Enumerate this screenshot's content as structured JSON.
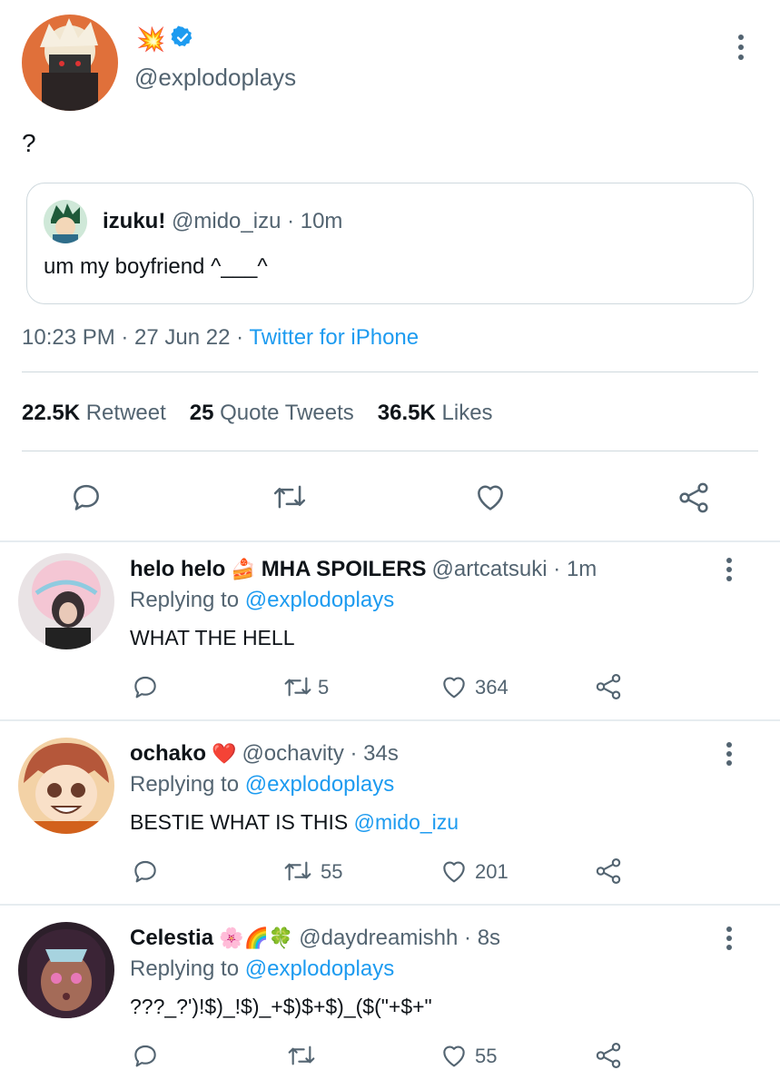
{
  "main_tweet": {
    "emoji": "💥",
    "handle": "@explodoplays",
    "text": "?",
    "quote": {
      "name": "izuku!",
      "handle_time": "@mido_izu · 10m",
      "text": "um my boyfriend ^___^"
    },
    "time_date": "10:23 PM · 27 Jun 22 · ",
    "source": "Twitter for iPhone",
    "stats": [
      {
        "value": "22.5K",
        "label": "Retweet"
      },
      {
        "value": "25",
        "label": "Quote Tweets"
      },
      {
        "value": "36.5K",
        "label": "Likes"
      }
    ]
  },
  "replies": [
    {
      "name": "helo helo",
      "emoji": "🍰",
      "name_suffix": "MHA SPOILERS",
      "handle_time": "@artcatsuki · 1m",
      "replying_prefix": "Replying to ",
      "replying_to": "@explodoplays",
      "text": "WHAT THE HELL",
      "text_mention": "",
      "retweets": "5",
      "likes": "364"
    },
    {
      "name": "ochako",
      "emoji": "❤️",
      "name_suffix": "",
      "handle_time": "@ochavity · 34s",
      "replying_prefix": "Replying to ",
      "replying_to": "@explodoplays",
      "text": "BESTIE WHAT IS THIS ",
      "text_mention": "@mido_izu",
      "retweets": "55",
      "likes": "201"
    },
    {
      "name": "Celestia",
      "emoji": "🌸🌈🍀",
      "name_suffix": "",
      "handle_time": "@daydreamishh · 8s",
      "replying_prefix": "Replying to ",
      "replying_to": "@explodoplays",
      "text": "???_?')!$)_!$)_+$)$+$)_($(\"+$+\"",
      "text_mention": "",
      "retweets": "",
      "likes": "55"
    }
  ],
  "colors": {
    "accent": "#1d9bf0",
    "muted": "#536471",
    "text": "#0f1419",
    "border": "#cfd9de"
  }
}
